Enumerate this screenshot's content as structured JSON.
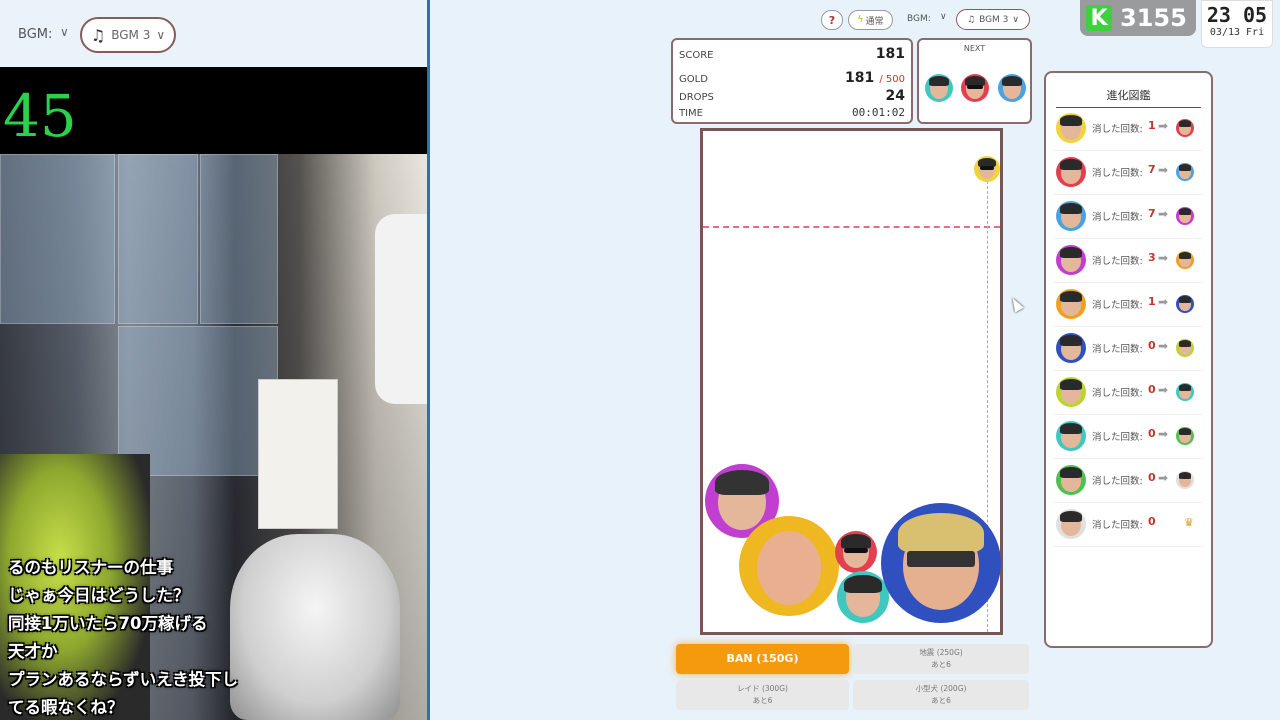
{
  "stream": {
    "bgm_label": "BGM:",
    "bgm_value": "BGM 3",
    "timer": "45",
    "chat": [
      "るのもリスナーの仕事",
      "じゃぁ今日はどうした？",
      "同接1万いたら70万稼げる",
      "天才か",
      "プランあるならずいえき投下し",
      "てる暇なくね？"
    ]
  },
  "toolbar": {
    "help_label": "?",
    "mode_label": "通常",
    "bgm_label": "BGM:",
    "bgm_value": "BGM 3"
  },
  "score_panel": {
    "score_label": "SCORE",
    "score_value": "181",
    "gold_label": "GOLD",
    "gold_value": "181",
    "gold_max": "/ 500",
    "drops_label": "DROPS",
    "drops_value": "24",
    "time_label": "TIME",
    "time_value": "00:01:02"
  },
  "next_panel": {
    "title": "NEXT"
  },
  "actions": {
    "ban": "BAN (150G)",
    "quake_line1": "地震 (250G)",
    "quake_line2": "あと6",
    "raid_line1": "レイド (300G)",
    "raid_line2": "あと6",
    "dog_line1": "小型犬 (200G)",
    "dog_line2": "あと6"
  },
  "evolution": {
    "title": "進化図鑑",
    "count_label": "消した回数:",
    "rows": [
      {
        "count": "1",
        "ring": "#f2d33a"
      },
      {
        "count": "7",
        "ring": "#e04050"
      },
      {
        "count": "7",
        "ring": "#4aa3e0"
      },
      {
        "count": "3",
        "ring": "#c13fd0"
      },
      {
        "count": "1",
        "ring": "#f0a020"
      },
      {
        "count": "0",
        "ring": "#3050c0"
      },
      {
        "count": "0",
        "ring": "#b8d630"
      },
      {
        "count": "0",
        "ring": "#40c8c0"
      },
      {
        "count": "0",
        "ring": "#50c050"
      },
      {
        "count": "0",
        "ring": "#e0e0e0"
      }
    ]
  },
  "overlay": {
    "k_logo": "K",
    "k_score": "3155",
    "clock_time": "23 05",
    "clock_date": "03/13 Fri"
  },
  "colors": {
    "accent_orange": "#f59a0c",
    "panel_border": "#8a6a6a",
    "timer_green": "#2bd14c",
    "k_green": "#3dd13d"
  }
}
